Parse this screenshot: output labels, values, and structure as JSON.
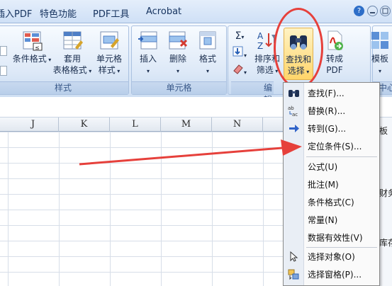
{
  "tabs": [
    {
      "label": "插入PDF"
    },
    {
      "label": "特色功能"
    },
    {
      "label": "PDF工具"
    },
    {
      "label": "Acrobat"
    }
  ],
  "title_controls": {
    "help": "?"
  },
  "ribbon": {
    "groups": [
      {
        "title": "样式"
      },
      {
        "title": "单元格"
      },
      {
        "title": "编辑"
      },
      {
        "title": "中心"
      }
    ],
    "buttons": {
      "conditional_format": "条件格式",
      "table_format_1": "套用",
      "table_format_2": "表格格式",
      "cell_style_1": "单元格",
      "cell_style_2": "样式",
      "insert": "插入",
      "delete": "删除",
      "format": "格式",
      "sort_filter_1": "排序和",
      "sort_filter_2": "筛选",
      "find_select_1": "查找和",
      "find_select_2": "选择",
      "to_pdf_1": "转成",
      "to_pdf_2": "PDF",
      "template": "模板"
    }
  },
  "columns": [
    "J",
    "K",
    "L",
    "M",
    "N"
  ],
  "menu": {
    "items": [
      {
        "label": "查找(F)...",
        "icon": "binoculars-icon"
      },
      {
        "label": "替换(R)...",
        "icon": "replace-icon"
      },
      {
        "label": "转到(G)...",
        "icon": "arrow-right-icon"
      },
      {
        "label": "定位条件(S)...",
        "icon": ""
      },
      {
        "label": "公式(U)",
        "icon": ""
      },
      {
        "label": "批注(M)",
        "icon": ""
      },
      {
        "label": "条件格式(C)",
        "icon": ""
      },
      {
        "label": "常量(N)",
        "icon": ""
      },
      {
        "label": "数据有效性(V)",
        "icon": ""
      },
      {
        "label": "选择对象(O)",
        "icon": "cursor-icon"
      },
      {
        "label": "选择窗格(P)...",
        "icon": "selection-pane-icon"
      }
    ]
  },
  "right_panel": {
    "texts": [
      "板",
      "财务",
      "库存"
    ]
  },
  "colors": {
    "annotation_red": "#e6403b",
    "accent": "#15325e"
  }
}
